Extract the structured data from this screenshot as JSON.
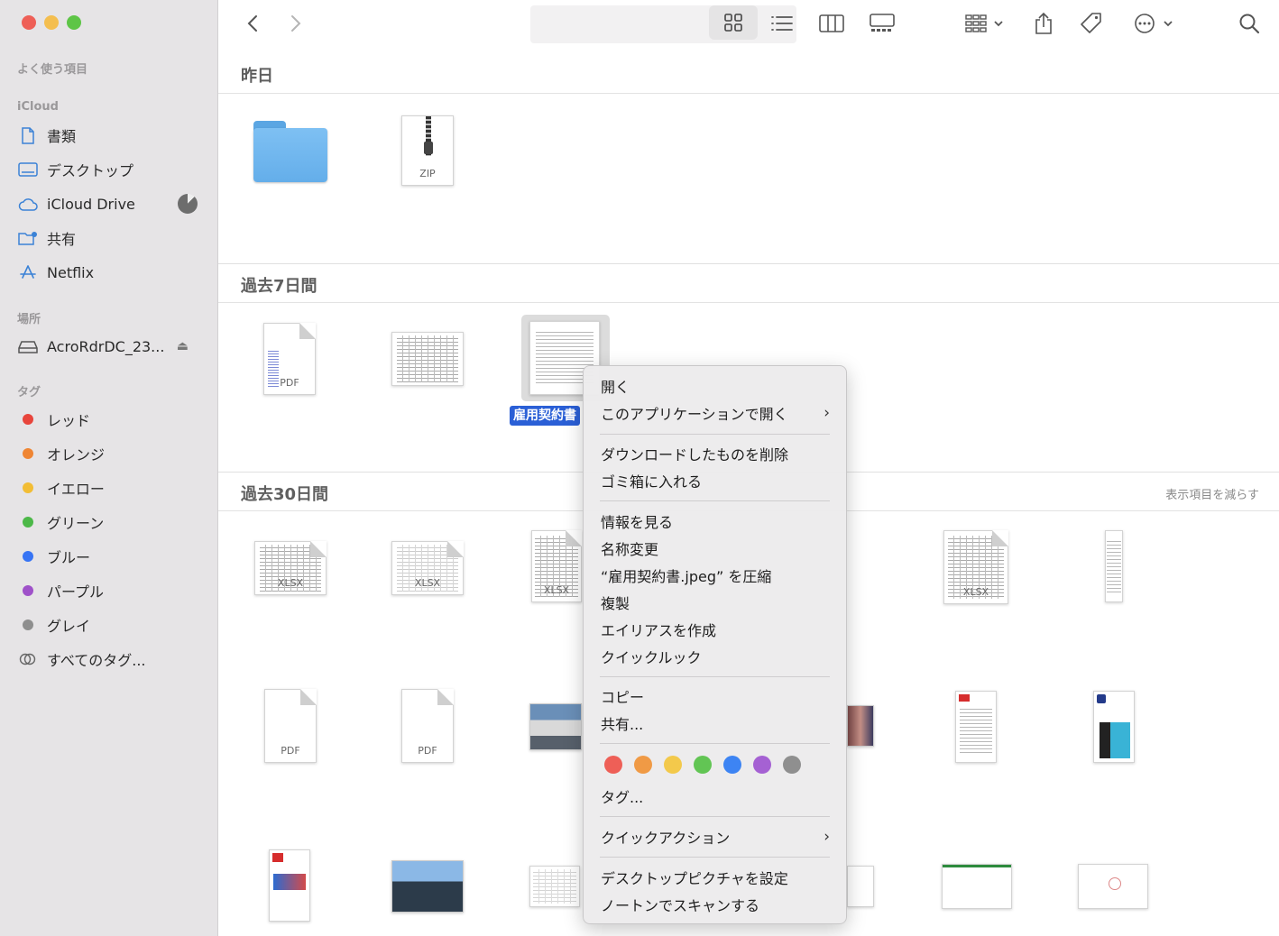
{
  "window": {
    "traffic_lights": [
      "#ee5f57",
      "#f4be4f",
      "#5ec547"
    ]
  },
  "sidebar": {
    "favorites_header": "よく使う項目",
    "icloud_header": "iCloud",
    "icloud_items": [
      {
        "label": "書類",
        "icon": "document-icon"
      },
      {
        "label": "デスクトップ",
        "icon": "desktop-icon"
      },
      {
        "label": "iCloud Drive",
        "icon": "cloud-icon"
      },
      {
        "label": "共有",
        "icon": "shared-folder-icon"
      },
      {
        "label": "Netflix",
        "icon": "app-store-icon"
      }
    ],
    "locations_header": "場所",
    "locations": [
      {
        "label": "AcroRdrDC_23...",
        "icon": "drive-icon"
      }
    ],
    "tags_header": "タグ",
    "tags": [
      {
        "label": "レッド",
        "color": "#e8453c"
      },
      {
        "label": "オレンジ",
        "color": "#ef8533"
      },
      {
        "label": "イエロー",
        "color": "#f2bd35"
      },
      {
        "label": "グリーン",
        "color": "#4cb848"
      },
      {
        "label": "ブルー",
        "color": "#3774f4"
      },
      {
        "label": "パープル",
        "color": "#9f51c9"
      },
      {
        "label": "グレイ",
        "color": "#8e8e8e"
      }
    ],
    "all_tags": "すべてのタグ..."
  },
  "toolbar": {
    "icons": [
      "back-icon",
      "forward-icon",
      "icon-view-icon",
      "list-view-icon",
      "column-view-icon",
      "gallery-view-icon",
      "group-icon",
      "share-icon",
      "tag-icon",
      "more-icon",
      "search-icon"
    ]
  },
  "groups": {
    "yesterday": "昨日",
    "last7": "過去7日間",
    "last30": "過去30日間",
    "show_less": "表示項目を減らす"
  },
  "files": {
    "zip_ext": "ZIP",
    "pdf_ext": "PDF",
    "xlsx_ext": "XLSX",
    "selected_label": "雇用契約書"
  },
  "context_menu": {
    "open": "開く",
    "open_with": "このアプリケーションで開く",
    "delete_download": "ダウンロードしたものを削除",
    "move_to_trash": "ゴミ箱に入れる",
    "get_info": "情報を見る",
    "rename": "名称変更",
    "compress": "“雇用契約書.jpeg” を圧縮",
    "duplicate": "複製",
    "make_alias": "エイリアスを作成",
    "quick_look": "クイックルック",
    "copy": "コピー",
    "share": "共有...",
    "tag_colors": [
      "#ee5f57",
      "#f09a45",
      "#f3c94b",
      "#62c554",
      "#3d84f3",
      "#a561d3",
      "#8f8f8f"
    ],
    "tags": "タグ...",
    "quick_actions": "クイックアクション",
    "set_desktop": "デスクトップピクチャを設定",
    "norton_scan": "ノートンでスキャンする"
  }
}
